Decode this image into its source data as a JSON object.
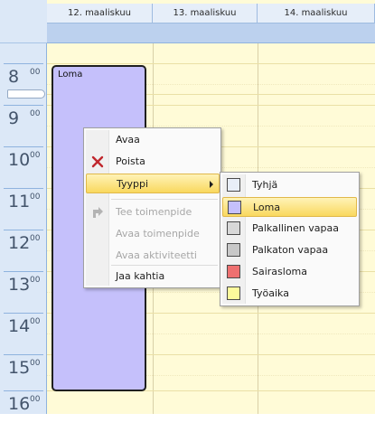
{
  "calendar": {
    "days": [
      "12. maaliskuu",
      "13. maaliskuu",
      "14. maaliskuu"
    ],
    "hours": [
      {
        "h": "8",
        "m": "00"
      },
      {
        "h": "9",
        "m": "00"
      },
      {
        "h": "10",
        "m": "00"
      },
      {
        "h": "11",
        "m": "00"
      },
      {
        "h": "12",
        "m": "00"
      },
      {
        "h": "13",
        "m": "00"
      },
      {
        "h": "14",
        "m": "00"
      },
      {
        "h": "15",
        "m": "00"
      },
      {
        "h": "16",
        "m": "00"
      }
    ],
    "appointment": {
      "label": "Loma",
      "color": "#c5c0fb"
    },
    "grid_color": "#fffbd7",
    "header_color": "#bcd1ee"
  },
  "context_menu": {
    "items": [
      {
        "label": "Avaa",
        "enabled": true,
        "icon": null
      },
      {
        "label": "Poista",
        "enabled": true,
        "icon": "delete-x-icon"
      },
      {
        "label": "Tyyppi",
        "enabled": true,
        "icon": null,
        "submenu": true,
        "highlighted": true
      },
      {
        "label": "Tee toimenpide",
        "enabled": false,
        "icon": "action-arrow-icon"
      },
      {
        "label": "Avaa toimenpide",
        "enabled": false,
        "icon": null
      },
      {
        "label": "Avaa aktiviteetti",
        "enabled": false,
        "icon": null
      },
      {
        "label": "Jaa kahtia",
        "enabled": true,
        "icon": null
      }
    ]
  },
  "type_submenu": {
    "items": [
      {
        "label": "Tyhjä",
        "color": "#e8eef8"
      },
      {
        "label": "Loma",
        "color": "#c5c0fb",
        "highlighted": true
      },
      {
        "label": "Palkallinen vapaa",
        "color": "#d8d8d8"
      },
      {
        "label": "Palkaton vapaa",
        "color": "#c8c8c8"
      },
      {
        "label": "Sairasloma",
        "color": "#ee7070"
      },
      {
        "label": "Työaika",
        "color": "#fdfb9c"
      }
    ]
  }
}
